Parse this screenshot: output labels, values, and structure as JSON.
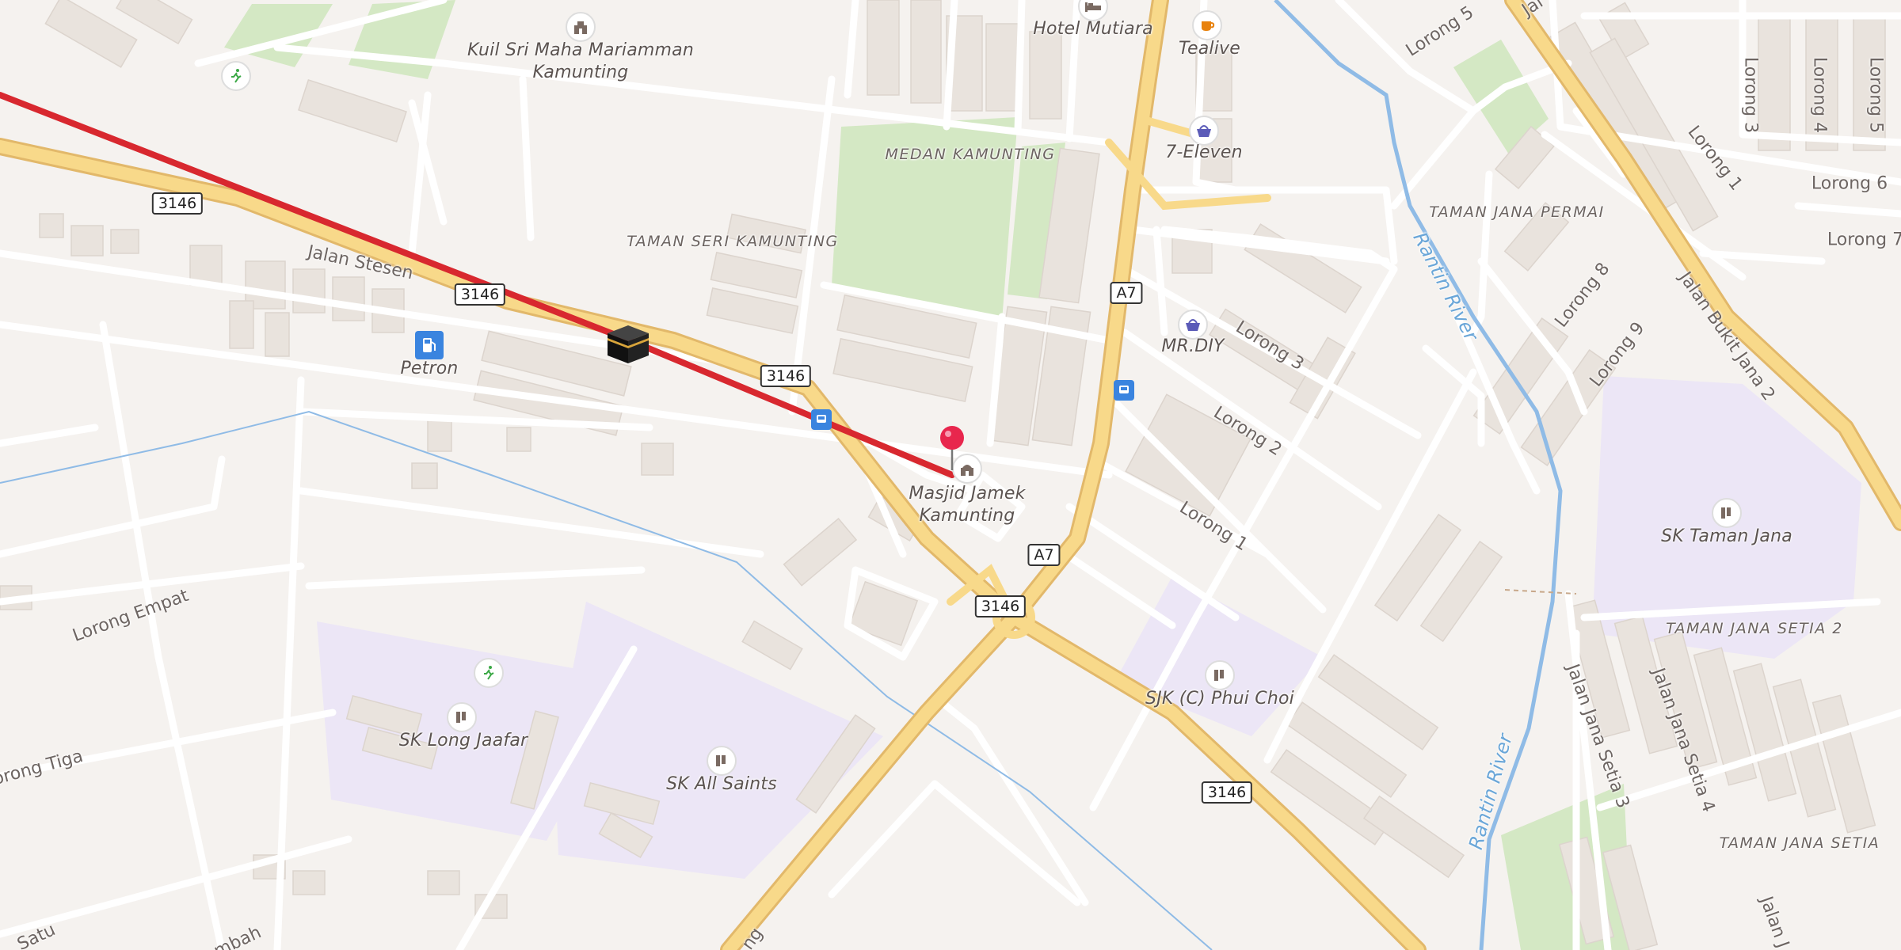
{
  "roads": {
    "shields": [
      "3146",
      "A7"
    ]
  },
  "pois": {
    "hotel_mutiara": "Hotel Mutiara",
    "kuil": "Kuil Sri Maha Mariamman Kamunting",
    "tealive": "Tealive",
    "seven_eleven": "7-Eleven",
    "mrdiy": "MR.DIY",
    "petron": "Petron",
    "masjid": "Masjid Jamek Kamunting",
    "sk_taman_jana": "SK Taman Jana",
    "sjk_phui_choi": "SJK (C) Phui Choi",
    "sk_long_jaafar": "SK Long Jaafar",
    "sk_all_saints": "SK All Saints"
  },
  "areas": {
    "medan": "MEDAN KAMUNTING",
    "taman_seri": "TAMAN SERI KAMUNTING",
    "taman_jana_permai": "TAMAN JANA PERMAI",
    "taman_jana_setia_2": "TAMAN JANA SETIA 2",
    "taman_jana_setia": "TAMAN JANA SETIA"
  },
  "streets": {
    "jalan_stesen": "Jalan Stesen",
    "lorong_empat": "Lorong Empat",
    "lorong_tiga": "orong Tiga",
    "satu": "Satu",
    "mbah": "mbah",
    "ng": "ng",
    "lorong_5_top": "Lorong 5",
    "jal_top": "Jal",
    "lorong_3_v": "Lorong 3",
    "lorong_4_v": "Lorong 4",
    "lorong_5_v": "Lorong 5",
    "lorong_1_a": "Lorong 1",
    "lorong_6": "Lorong 6",
    "lorong_7": "Lorong 7",
    "lorong_8": "Lorong 8",
    "lorong_9": "Lorong 9",
    "jalan_bukit_jana_2": "Jalan Bukit Jana 2",
    "lorong_3_b": "Lorong 3",
    "lorong_2": "Lorong 2",
    "lorong_1_b": "Lorong 1",
    "jalan_jana_setia_3": "Jalan Jana Setia 3",
    "jalan_jana_setia_4": "Jalan Jana Setia 4",
    "jalan_j": "Jalan J",
    "rantin_1": "Rantin River",
    "rantin_2": "Rantin River"
  },
  "colors": {
    "background": "#f5f2ef",
    "main_road": "#f8d98a",
    "main_road_casing": "#e2b86a",
    "school_area": "#ece6f6",
    "park": "#d4e8c4",
    "river": "#8fbbe6",
    "route_line": "#d8282f",
    "pin": "#e8264d"
  },
  "icons": {
    "hotel": "bed-icon",
    "temple": "temple-icon",
    "cafe": "cup-icon",
    "shop": "basket-icon",
    "fuel": "fuel-pump-icon",
    "mosque": "mosque-icon",
    "school": "school-icon",
    "sport": "running-person-icon",
    "bus": "bus-stop-icon",
    "kaaba": "kaaba-icon",
    "pin": "location-pin-icon"
  }
}
